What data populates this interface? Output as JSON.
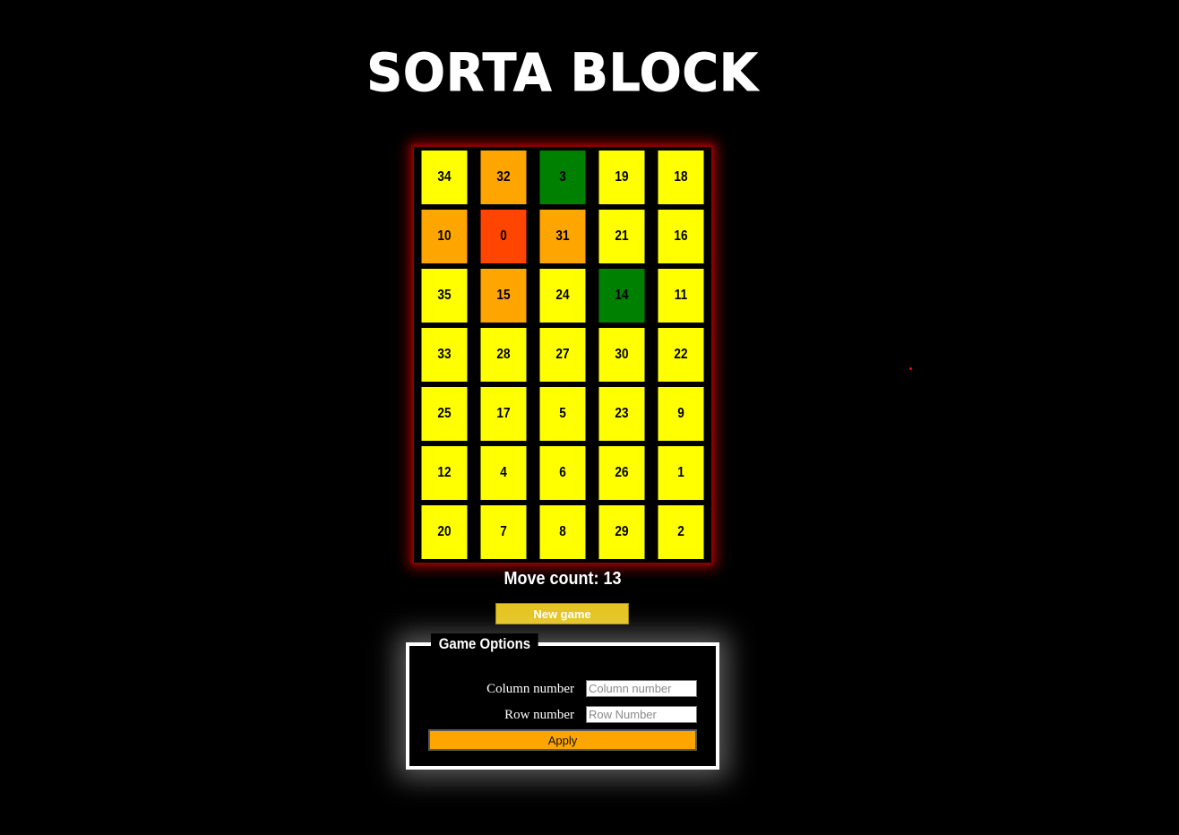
{
  "title": "Sorta Block",
  "colors": {
    "yellow": "#ffff00",
    "orange": "#ffa500",
    "red_orange": "#ff4500",
    "green": "#008000",
    "board_glow": "#8b0000",
    "new_game_button": "#e5c422",
    "apply_button": "#ffa500"
  },
  "board": {
    "columns": 5,
    "rows": 7,
    "cells": [
      {
        "value": "34",
        "color": "#ffff00"
      },
      {
        "value": "32",
        "color": "#ffa500"
      },
      {
        "value": "3",
        "color": "#008000"
      },
      {
        "value": "19",
        "color": "#ffff00"
      },
      {
        "value": "18",
        "color": "#ffff00"
      },
      {
        "value": "10",
        "color": "#ffa500"
      },
      {
        "value": "0",
        "color": "#ff4500"
      },
      {
        "value": "31",
        "color": "#ffa500"
      },
      {
        "value": "21",
        "color": "#ffff00"
      },
      {
        "value": "16",
        "color": "#ffff00"
      },
      {
        "value": "35",
        "color": "#ffff00"
      },
      {
        "value": "15",
        "color": "#ffa500"
      },
      {
        "value": "24",
        "color": "#ffff00"
      },
      {
        "value": "14",
        "color": "#008000"
      },
      {
        "value": "11",
        "color": "#ffff00"
      },
      {
        "value": "33",
        "color": "#ffff00"
      },
      {
        "value": "28",
        "color": "#ffff00"
      },
      {
        "value": "27",
        "color": "#ffff00"
      },
      {
        "value": "30",
        "color": "#ffff00"
      },
      {
        "value": "22",
        "color": "#ffff00"
      },
      {
        "value": "25",
        "color": "#ffff00"
      },
      {
        "value": "17",
        "color": "#ffff00"
      },
      {
        "value": "5",
        "color": "#ffff00"
      },
      {
        "value": "23",
        "color": "#ffff00"
      },
      {
        "value": "9",
        "color": "#ffff00"
      },
      {
        "value": "12",
        "color": "#ffff00"
      },
      {
        "value": "4",
        "color": "#ffff00"
      },
      {
        "value": "6",
        "color": "#ffff00"
      },
      {
        "value": "26",
        "color": "#ffff00"
      },
      {
        "value": "1",
        "color": "#ffff00"
      },
      {
        "value": "20",
        "color": "#ffff00"
      },
      {
        "value": "7",
        "color": "#ffff00"
      },
      {
        "value": "8",
        "color": "#ffff00"
      },
      {
        "value": "29",
        "color": "#ffff00"
      },
      {
        "value": "2",
        "color": "#ffff00"
      }
    ]
  },
  "move_count": {
    "label": "Move count: 13"
  },
  "buttons": {
    "new_game": "New game",
    "apply": "Apply"
  },
  "options": {
    "legend": "Game Options",
    "column_label": "Column number",
    "column_value": "",
    "column_placeholder": "Column number",
    "row_label": "Row number",
    "row_value": "",
    "row_placeholder": "Row Number"
  }
}
